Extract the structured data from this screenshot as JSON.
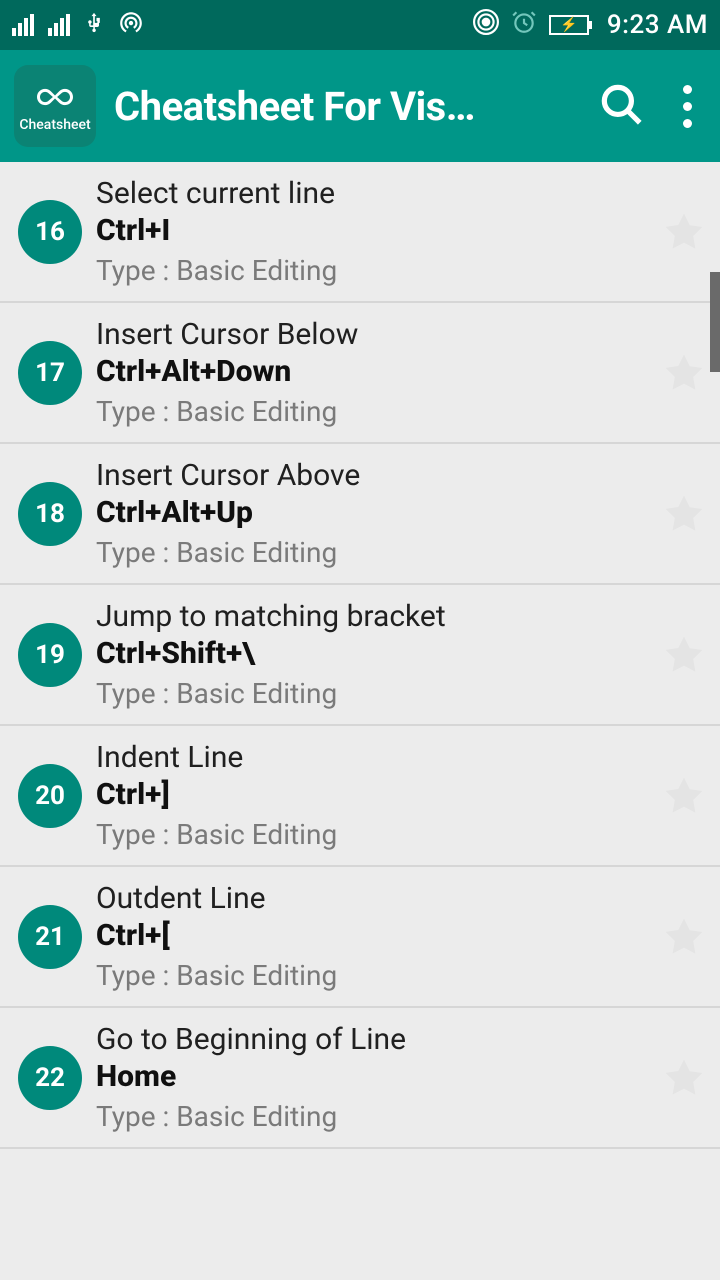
{
  "status": {
    "time": "9:23 AM"
  },
  "appbar": {
    "icon_label": "Cheatsheet",
    "title": "Cheatsheet For Vis…"
  },
  "type_prefix": "Type : ",
  "items": [
    {
      "num": "16",
      "title": "Select current line",
      "shortcut": "Ctrl+I",
      "type": "Basic Editing"
    },
    {
      "num": "17",
      "title": "Insert Cursor Below",
      "shortcut": "Ctrl+Alt+Down",
      "type": "Basic Editing"
    },
    {
      "num": "18",
      "title": "Insert Cursor Above",
      "shortcut": "Ctrl+Alt+Up",
      "type": "Basic Editing"
    },
    {
      "num": "19",
      "title": "Jump to matching bracket",
      "shortcut": "Ctrl+Shift+\\",
      "type": "Basic Editing"
    },
    {
      "num": "20",
      "title": "Indent Line",
      "shortcut": "Ctrl+]",
      "type": "Basic Editing"
    },
    {
      "num": "21",
      "title": "Outdent Line",
      "shortcut": "Ctrl+[",
      "type": "Basic Editing"
    },
    {
      "num": "22",
      "title": "Go to Beginning of Line",
      "shortcut": "Home",
      "type": "Basic Editing"
    }
  ]
}
